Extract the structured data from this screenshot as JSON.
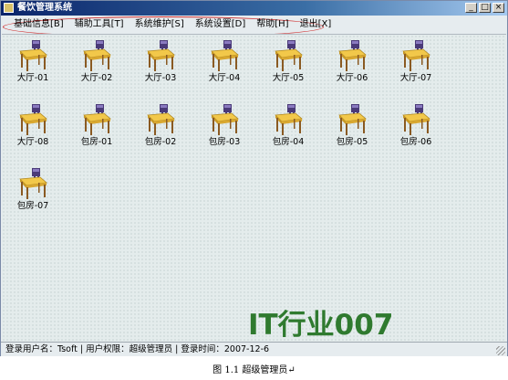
{
  "window": {
    "title": "餐饮管理系统"
  },
  "menu": [
    "基础信息[B]",
    "辅助工具[T]",
    "系统维护[S]",
    "系统设置[D]",
    "帮助[H]",
    "退出[X]"
  ],
  "tables": [
    "大厅-01",
    "大厅-02",
    "大厅-03",
    "大厅-04",
    "大厅-05",
    "大厅-06",
    "大厅-07",
    "大厅-08",
    "包房-01",
    "包房-02",
    "包房-03",
    "包房-04",
    "包房-05",
    "包房-06",
    "包房-07"
  ],
  "watermark": "IT行业007",
  "status": "登录用户名：Tsoft | 用户权限：超级管理员 | 登录时间：2007-12-6",
  "caption": "图 1.1   超级管理员↵",
  "colors": {
    "table_top": "#f2c84a",
    "table_leg": "#8a5a22",
    "chair": "#4a3a78",
    "watermark": "#2f7a2f"
  }
}
